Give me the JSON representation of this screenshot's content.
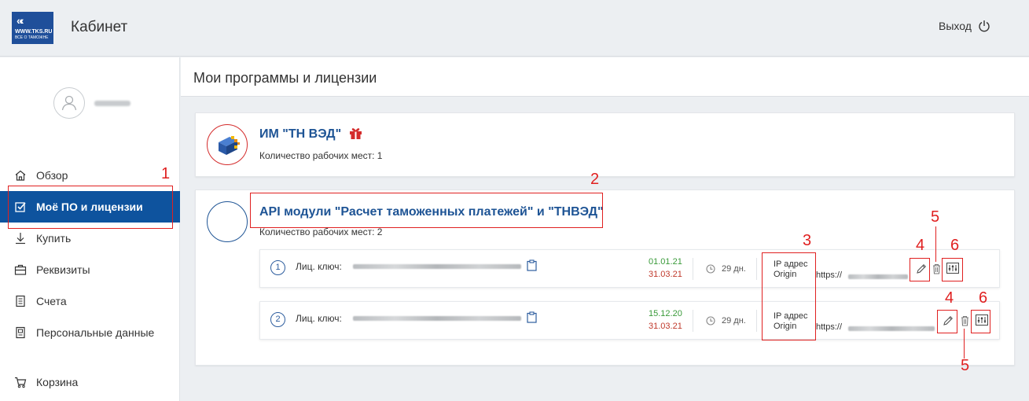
{
  "header": {
    "logo_line1": "WWW.TKS.RU",
    "logo_line2": "ВСЕ О ТАМОЖНЕ",
    "title": "Кабинет",
    "logout_label": "Выход"
  },
  "sidebar": {
    "items": [
      {
        "label": "Обзор",
        "icon": "home-icon"
      },
      {
        "label": "Моё ПО и лицензии",
        "icon": "checkbox-icon",
        "active": true
      },
      {
        "label": "Купить",
        "icon": "download-icon"
      },
      {
        "label": "Реквизиты",
        "icon": "briefcase-icon"
      },
      {
        "label": "Счета",
        "icon": "invoice-icon"
      },
      {
        "label": "Персональные данные",
        "icon": "id-card-icon"
      },
      {
        "label": "Корзина",
        "icon": "cart-icon"
      }
    ]
  },
  "main": {
    "title": "Мои программы и лицензии",
    "products": [
      {
        "title": "ИМ \"ТН ВЭД\"",
        "seats_label": "Количество рабочих мест:",
        "seats": "1"
      },
      {
        "title": "API модули \"Расчет таможенных платежей\" и \"ТНВЭД\"",
        "seats_label": "Количество рабочих мест:",
        "seats": "2",
        "licenses": [
          {
            "num": "1",
            "key_label": "Лиц. ключ:",
            "start": "01.01.21",
            "end": "31.03.21",
            "days": "29 дн.",
            "ip_label": "IP адрес",
            "origin_label": "Origin",
            "url_prefix": "https://"
          },
          {
            "num": "2",
            "key_label": "Лиц. ключ:",
            "start": "15.12.20",
            "end": "31.03.21",
            "days": "29 дн.",
            "ip_label": "IP адрес",
            "origin_label": "Origin",
            "url_prefix": "https://"
          }
        ]
      }
    ]
  },
  "annotations": {
    "n1": "1",
    "n2": "2",
    "n3": "3",
    "n4a": "4",
    "n4b": "4",
    "n5a": "5",
    "n5b": "5",
    "n6a": "6",
    "n6b": "6"
  },
  "colors": {
    "accent": "#0e539e",
    "title_blue": "#1e5495",
    "annotation_red": "#e02020",
    "start_date_green": "#3a9a3a",
    "end_date_red": "#c0392b"
  }
}
